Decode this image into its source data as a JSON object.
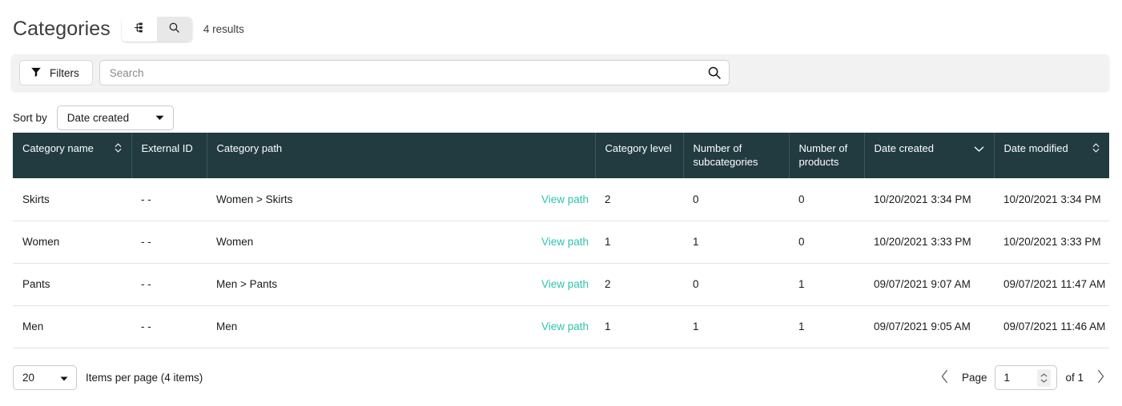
{
  "header": {
    "title": "Categories",
    "results_count": "4 results",
    "view_toggle": [
      {
        "name": "tree-view",
        "icon": "tree-icon",
        "active": false
      },
      {
        "name": "search-view",
        "icon": "search-icon",
        "active": true
      }
    ]
  },
  "filter_bar": {
    "filters_label": "Filters",
    "filter_icon": "funnel-icon",
    "search_value": "",
    "search_placeholder": "Search",
    "search_icon": "magnifier-icon"
  },
  "sort": {
    "label": "Sort by",
    "value": "Date created",
    "caret_icon": "chevron-down-icon"
  },
  "table": {
    "columns": [
      {
        "label": "Category name",
        "sort_icon": "sort-updown-icon"
      },
      {
        "label": "External ID",
        "sort_icon": ""
      },
      {
        "label": "Category path",
        "sort_icon": ""
      },
      {
        "label": "Category level",
        "sort_icon": ""
      },
      {
        "label": "Number of subcategories",
        "sort_icon": ""
      },
      {
        "label": "Number of products",
        "sort_icon": ""
      },
      {
        "label": "Date created",
        "sort_icon": "chevron-down-icon"
      },
      {
        "label": "Date modified",
        "sort_icon": "sort-updown-icon"
      }
    ],
    "view_path_label": "View path",
    "rows": [
      {
        "category_name": "Skirts",
        "external_id": "- -",
        "category_path": "Women > Skirts",
        "category_level": "2",
        "number_of_subcategories": "0",
        "number_of_products": "0",
        "date_created": "10/20/2021 3:34 PM",
        "date_modified": "10/20/2021 3:34 PM"
      },
      {
        "category_name": "Women",
        "external_id": "- -",
        "category_path": "Women",
        "category_level": "1",
        "number_of_subcategories": "1",
        "number_of_products": "0",
        "date_created": "10/20/2021 3:33 PM",
        "date_modified": "10/20/2021 3:33 PM"
      },
      {
        "category_name": "Pants",
        "external_id": "- -",
        "category_path": "Men > Pants",
        "category_level": "2",
        "number_of_subcategories": "0",
        "number_of_products": "1",
        "date_created": "09/07/2021 9:07 AM",
        "date_modified": "09/07/2021 11:47 AM"
      },
      {
        "category_name": "Men",
        "external_id": "- -",
        "category_path": "Men",
        "category_level": "1",
        "number_of_subcategories": "1",
        "number_of_products": "1",
        "date_created": "09/07/2021 9:05 AM",
        "date_modified": "09/07/2021 11:46 AM"
      }
    ]
  },
  "footer": {
    "items_per_page_value": "20",
    "items_per_page_label": "Items per page (4 items)",
    "prev_icon": "chevron-left-icon",
    "next_icon": "chevron-right-icon",
    "page_label": "Page",
    "page_value": "1",
    "of_label": "of 1"
  },
  "colors": {
    "table_header_bg": "#213b41",
    "link_teal": "#2ec4ad",
    "filter_bar_bg": "#f2f2f2",
    "row_divider": "#e2e2e2"
  }
}
